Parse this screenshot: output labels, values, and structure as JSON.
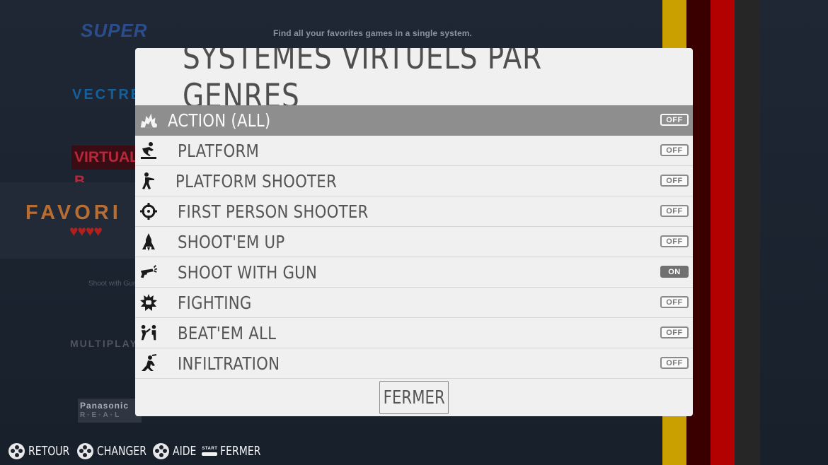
{
  "background": {
    "tagline": "Find all your favorites games in a single system.",
    "logos": {
      "super": "SUPER",
      "vectrex": "VECTREX",
      "virtual_boy": "VIRTUAL B",
      "favorites": "FAVORI",
      "favorites_hearts": "♥♥♥♥",
      "shoot_with_gun": "Shoot with Gun",
      "multiplayer": "MULTIPLAY",
      "panasonic": "Panasonic",
      "real": "R·E·A·L"
    },
    "stripe_colors": [
      "#c9a000",
      "#3a0000",
      "#b30000",
      "#2a2a2a",
      "#1f2735"
    ]
  },
  "modal": {
    "title": "SYSTÈMES VIRTUELS PAR GENRES",
    "rows": [
      {
        "label": "ACTION (ALL)",
        "icon": "explosion-icon",
        "state": "OFF",
        "selected": true
      },
      {
        "label": "PLATFORM",
        "icon": "platform-jump-icon",
        "state": "OFF"
      },
      {
        "label": "PLATFORM SHOOTER",
        "icon": "running-shooter-icon",
        "state": "OFF"
      },
      {
        "label": "FIRST PERSON SHOOTER",
        "icon": "crosshair-icon",
        "state": "OFF"
      },
      {
        "label": "SHOOT'EM UP",
        "icon": "spaceship-icon",
        "state": "OFF"
      },
      {
        "label": "SHOOT WITH GUN",
        "icon": "revolver-icon",
        "state": "ON"
      },
      {
        "label": "FIGHTING",
        "icon": "punch-burst-icon",
        "state": "OFF"
      },
      {
        "label": "BEAT'EM ALL",
        "icon": "kick-fighter-icon",
        "state": "OFF"
      },
      {
        "label": "INFILTRATION",
        "icon": "sneaking-ninja-icon",
        "state": "OFF"
      }
    ],
    "close_label": "FERMER"
  },
  "helpbar": {
    "items": [
      {
        "label": "RETOUR",
        "icon": "gamepad-buttons-icon"
      },
      {
        "label": "CHANGER",
        "icon": "gamepad-buttons-icon"
      },
      {
        "label": "AIDE",
        "icon": "gamepad-buttons-icon"
      },
      {
        "label": "FERMER",
        "icon": "start-button-icon",
        "badge": "START"
      }
    ]
  }
}
